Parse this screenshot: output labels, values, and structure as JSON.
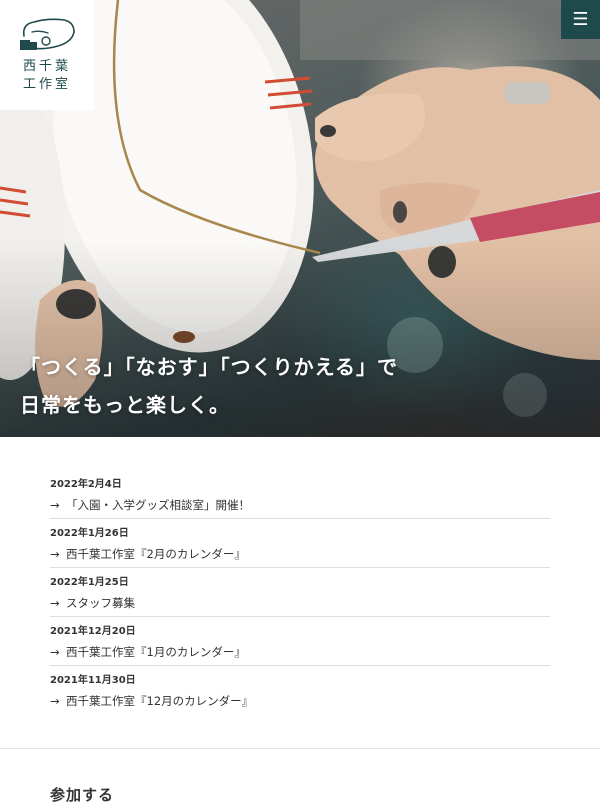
{
  "logo": {
    "line1": "西千葉",
    "line2": "工作室",
    "icon": "hand-box-icon"
  },
  "menu": {
    "icon": "hamburger-icon",
    "label": "☰"
  },
  "hero": {
    "headline_line1": "「つくる」「なおす」「つくりかえる」で",
    "headline_line2": "日常をもっと楽しく。"
  },
  "news": {
    "arrow": "→",
    "items": [
      {
        "date": "2022年2月4日",
        "title": "「入園・入学グッズ相談室」開催！"
      },
      {
        "date": "2022年1月26日",
        "title": "西千葉工作室『2月のカレンダー』"
      },
      {
        "date": "2022年1月25日",
        "title": "スタッフ募集"
      },
      {
        "date": "2021年12月20日",
        "title": "西千葉工作室『1月のカレンダー』"
      },
      {
        "date": "2021年11月30日",
        "title": "西千葉工作室『12月のカレンダー』"
      }
    ]
  },
  "section": {
    "heading": "参加する"
  },
  "colors": {
    "brand": "#1f4a4c",
    "text": "#333333",
    "divider": "#dddddd"
  }
}
